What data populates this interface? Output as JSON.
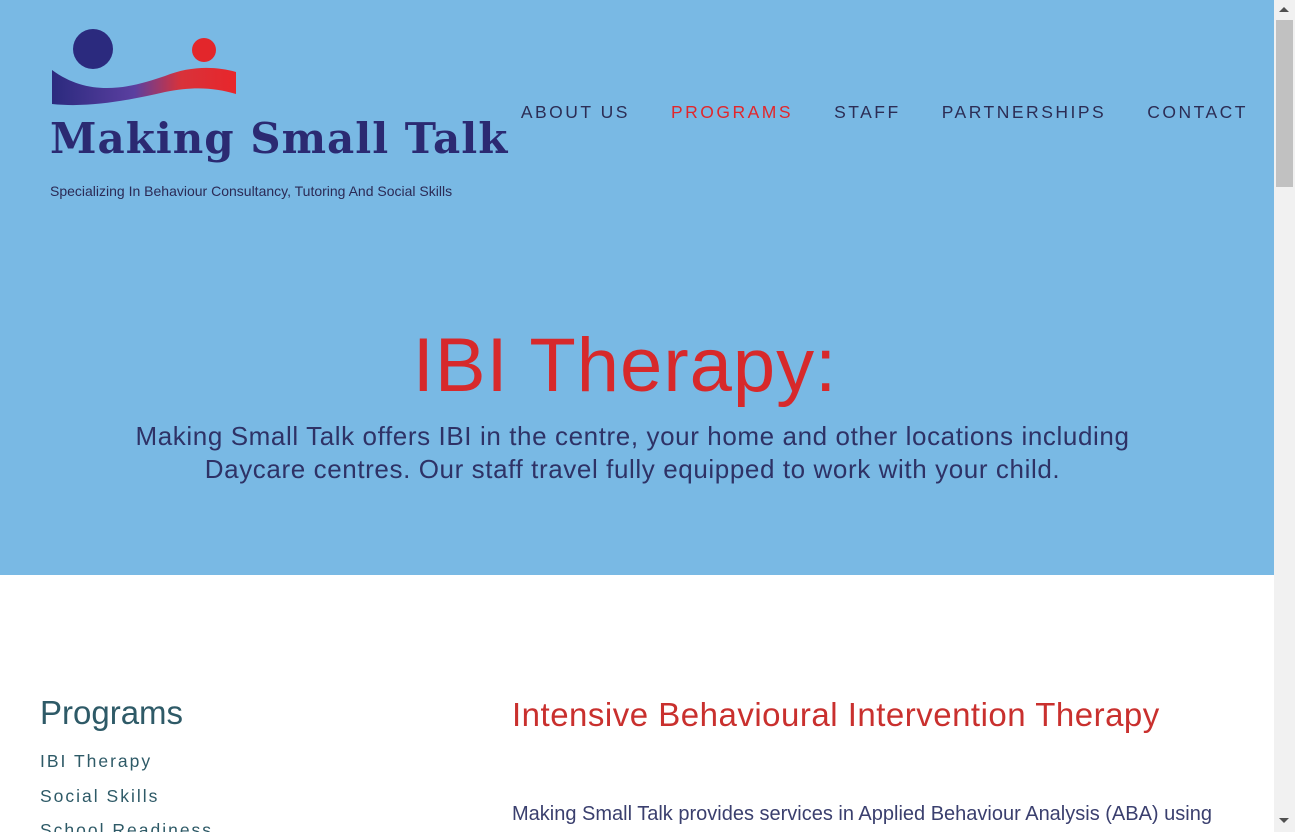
{
  "brand": {
    "name": "Making Small Talk",
    "tagline": "Specializing In Behaviour Consultancy, Tutoring And Social Skills"
  },
  "nav": {
    "items": [
      {
        "label": "ABOUT US"
      },
      {
        "label": "PROGRAMS",
        "active": true
      },
      {
        "label": "STAFF"
      },
      {
        "label": "PARTNERSHIPS"
      },
      {
        "label": "CONTACT"
      }
    ]
  },
  "hero": {
    "title": "IBI Therapy:",
    "subtitle": "Making Small Talk offers IBI in the centre, your home and other locations including Daycare centres. Our staff travel fully equipped to work with your child."
  },
  "sidebar": {
    "title": "Programs",
    "links": [
      {
        "label": "IBI Therapy"
      },
      {
        "label": "Social Skills"
      },
      {
        "label": "School Readiness"
      }
    ]
  },
  "main": {
    "heading": "Intensive Behavioural Intervention Therapy",
    "paragraph": "Making Small Talk provides services in Applied Behaviour Analysis (ABA) using"
  },
  "colors": {
    "hero_bg": "#79b9e4",
    "accent_red": "#d7292b",
    "navy": "#2b2a72"
  },
  "icons": {
    "logo": "two-figures-wave-logo"
  }
}
